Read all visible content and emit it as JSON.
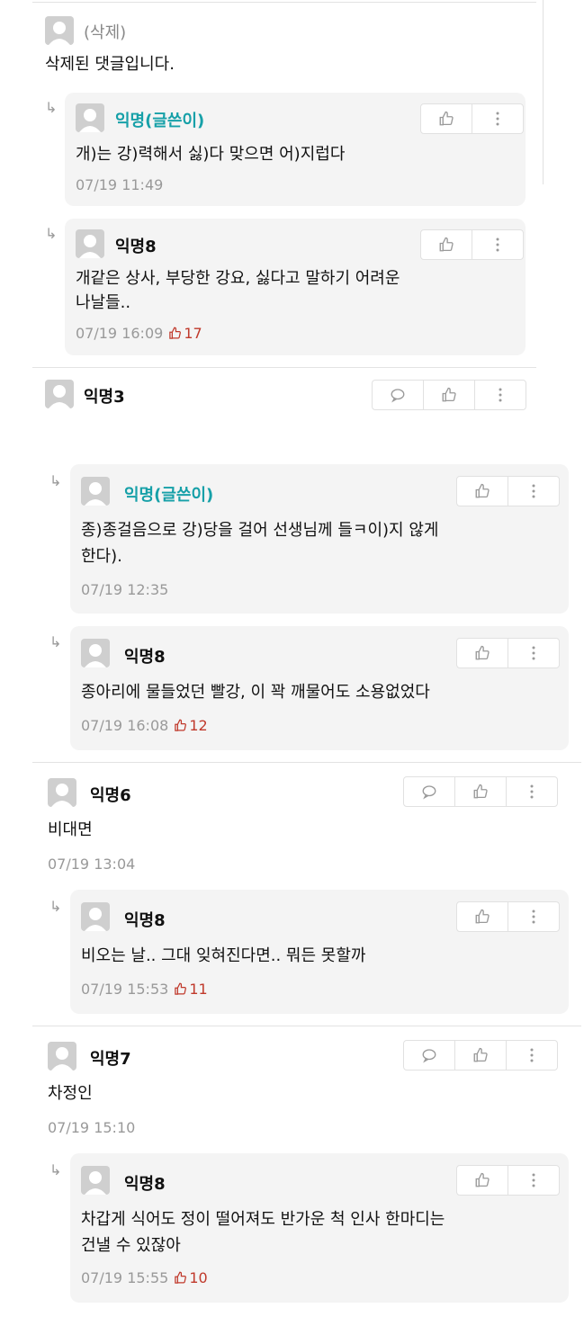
{
  "comments": [
    {
      "name": "(삭제)",
      "text": [
        "삭제된 댓글입니다."
      ],
      "replies": [
        {
          "name": "익명(글쓴이)",
          "text": [
            "개)는 강)력해서 싫)다 맞으면 어)지럽다"
          ],
          "date": "07/19 11:49",
          "likes": null
        },
        {
          "name": "익명8",
          "text": [
            "개같은 상사, 부당한 강요, 싫다고 말하기 어려운",
            "나날들.."
          ],
          "date": "07/19 16:09",
          "likes": "17"
        }
      ]
    },
    {
      "name": "익명3",
      "text": [],
      "replies": [
        {
          "name": "익명(글쓴이)",
          "text": [
            "종)종걸음으로 강)당을 걸어 선생님께 들ㅋ이)지 않게",
            "한다)."
          ],
          "date": "07/19 12:35",
          "likes": null
        },
        {
          "name": "익명8",
          "text": [
            "종아리에 물들었던 빨강, 이 꽉 깨물어도 소용없었다"
          ],
          "date": "07/19 16:08",
          "likes": "12"
        }
      ]
    },
    {
      "name": "익명6",
      "text": [
        "비대면"
      ],
      "date": "07/19 13:04",
      "replies": [
        {
          "name": "익명8",
          "text": [
            "비오는 날.. 그대 잊혀진다면.. 뭐든 못할까"
          ],
          "date": "07/19 15:53",
          "likes": "11"
        }
      ]
    },
    {
      "name": "익명7",
      "text": [
        "차정인"
      ],
      "date": "07/19 15:10",
      "replies": [
        {
          "name": "익명8",
          "text": [
            "차갑게 식어도 정이 떨어져도 반가운 척 인사 한마디는",
            "건낼 수 있잖아"
          ],
          "date": "07/19 15:55",
          "likes": "10"
        }
      ]
    }
  ],
  "icons": {
    "avatar": "default-avatar-icon",
    "reply_arrow": "reply-arrow-icon",
    "comment": "comment-icon",
    "like": "thumbs-up-icon",
    "more": "more-vertical-icon"
  },
  "colors": {
    "author_name": "#16a0a8",
    "like_count": "#c0392b",
    "meta_text": "#999999",
    "reply_background": "#f4f4f4"
  }
}
